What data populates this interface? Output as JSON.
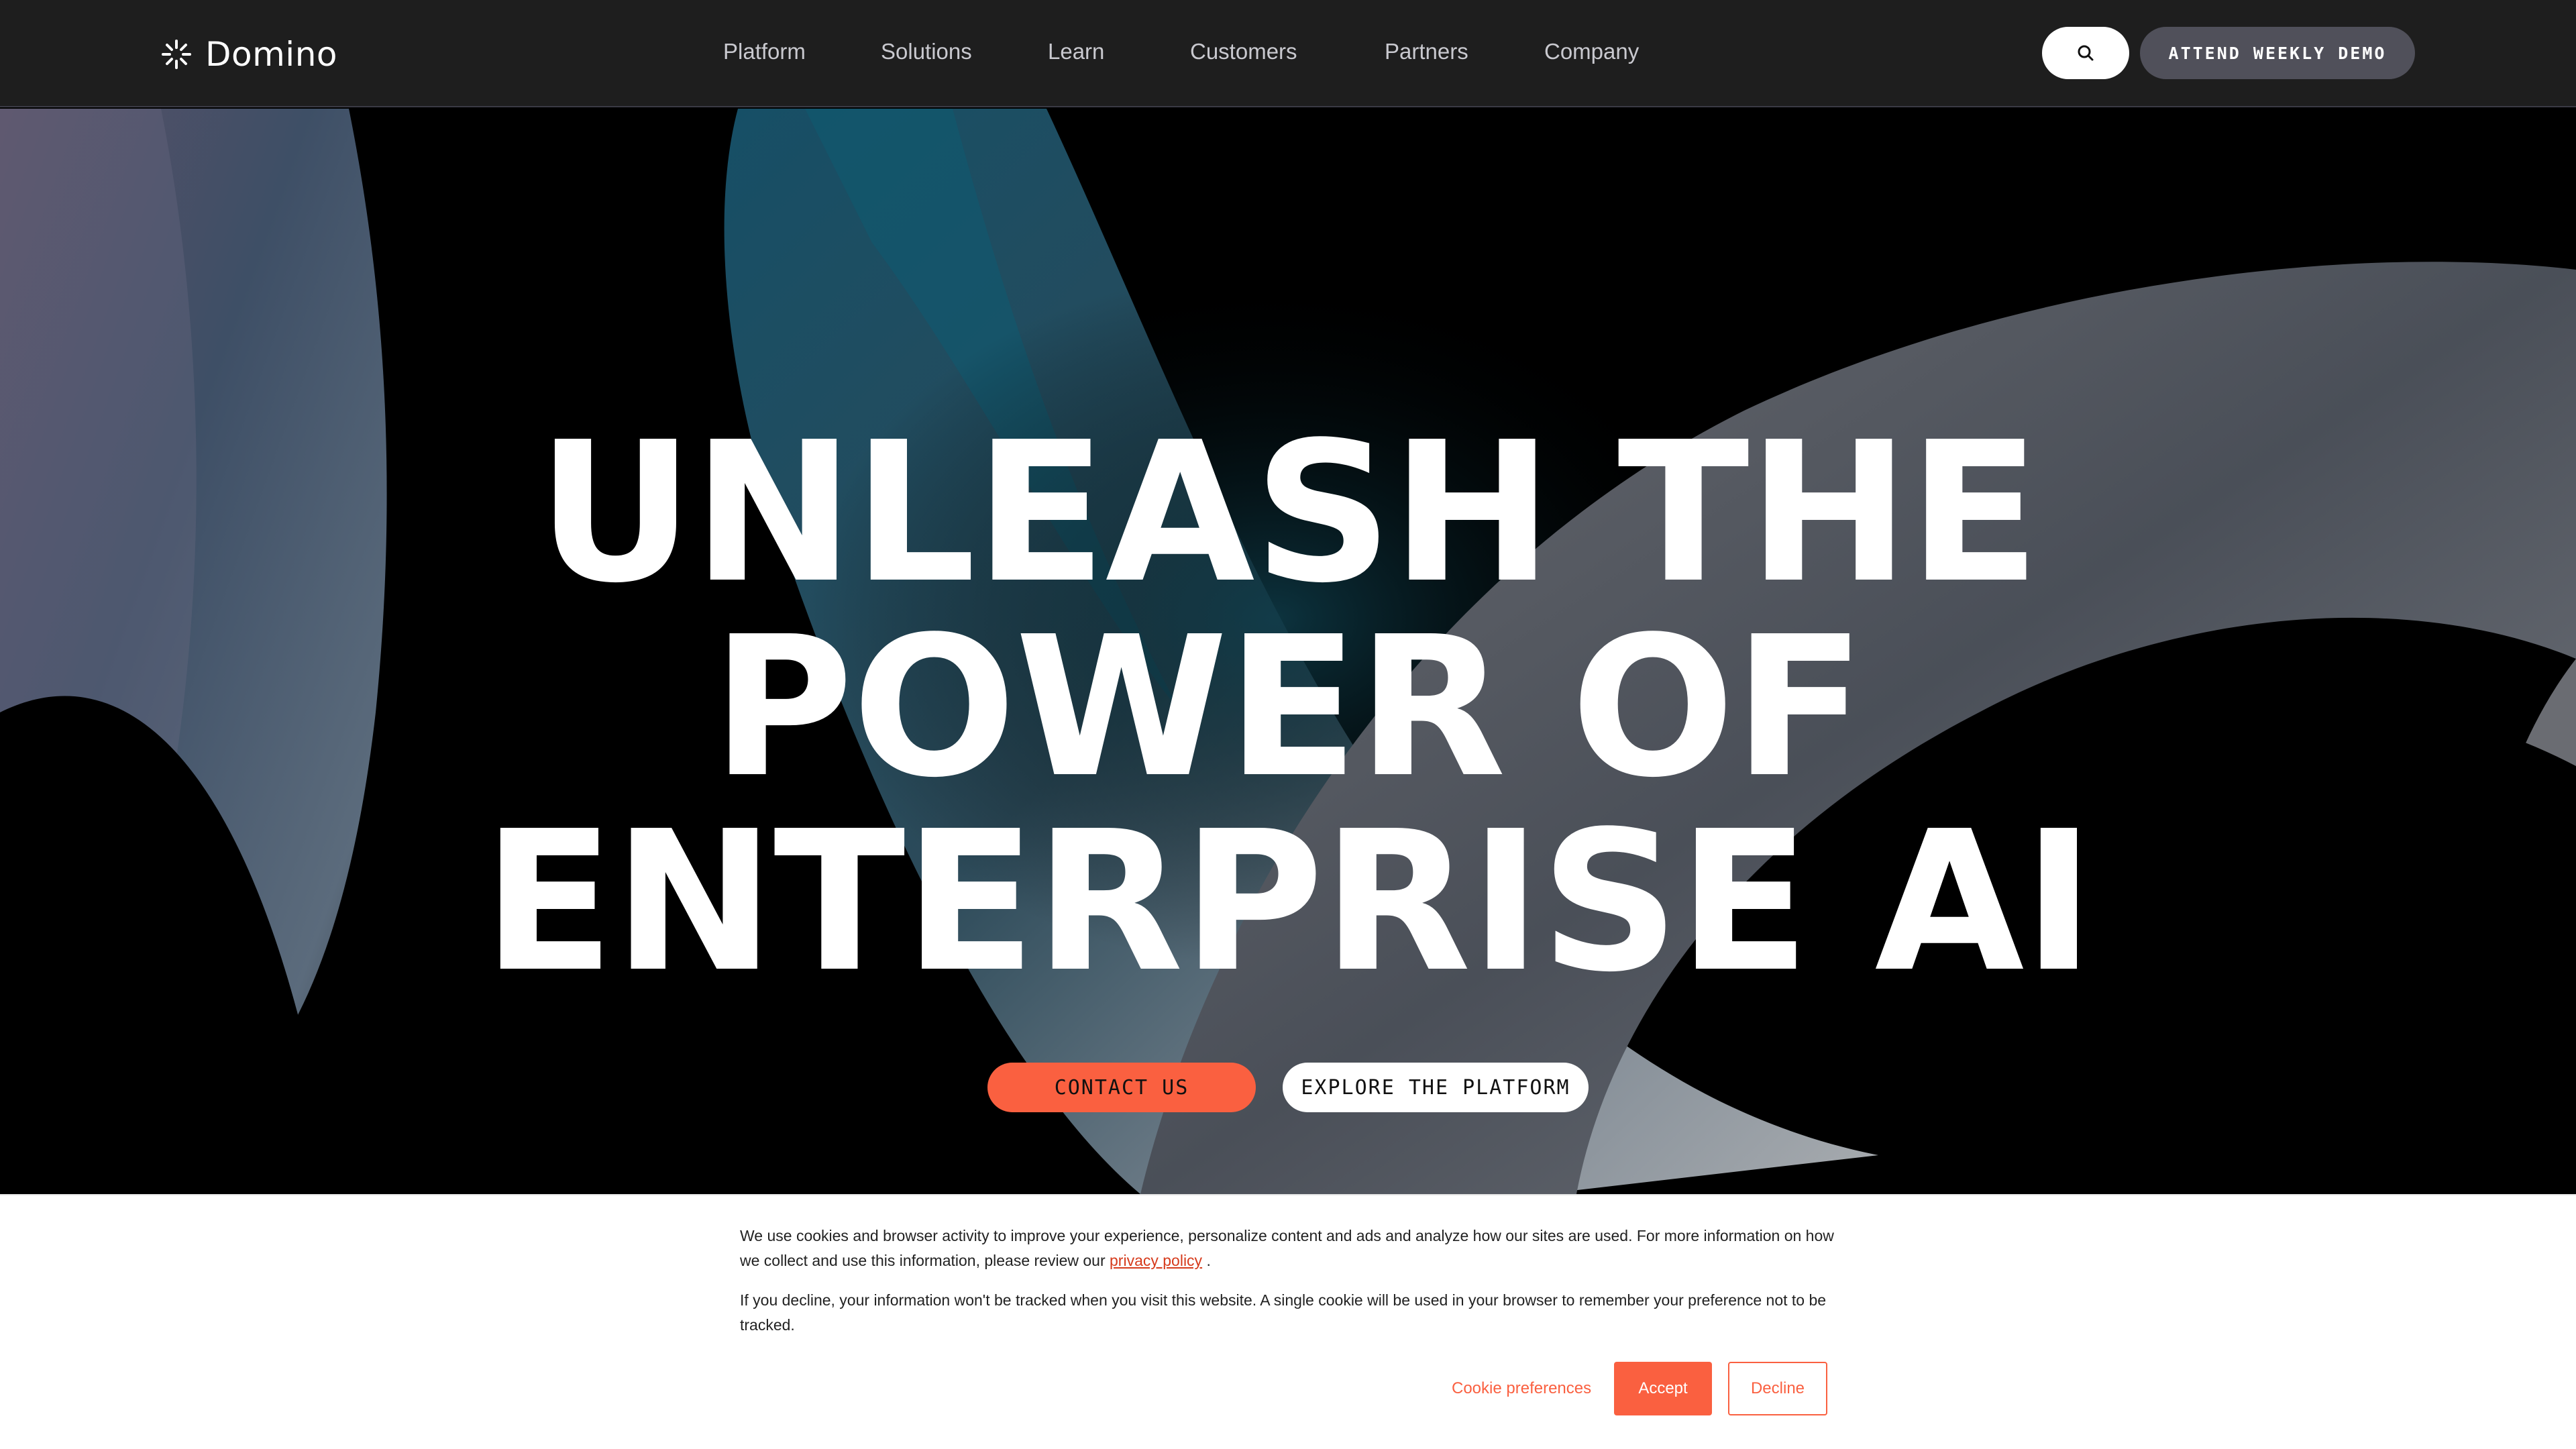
{
  "nav": {
    "logo_text": "Domino",
    "logo_icon": "domino-starburst-icon",
    "items": [
      {
        "label": "Platform"
      },
      {
        "label": "Solutions"
      },
      {
        "label": "Learn"
      },
      {
        "label": "Customers"
      },
      {
        "label": "Partners"
      },
      {
        "label": "Company"
      }
    ],
    "search_icon": "search-icon",
    "demo_label": "ATTEND WEEKLY DEMO"
  },
  "hero": {
    "headline_lines": [
      "UNLEASH THE",
      "POWER OF",
      "ENTERPRISE AI"
    ],
    "contact_label": "CONTACT US",
    "explore_label": "EXPLORE THE PLATFORM"
  },
  "cookie": {
    "p1_before": "We use cookies and browser activity to improve your experience, personalize content and ads and analyze how our sites are used. For more information on how we collect and use this information, please review our ",
    "p1_link": "privacy policy",
    "p1_after": " .",
    "p2": "If you decline, your information won't be tracked when you visit this website. A single cookie will be used in your browser to remember your preference not to be tracked.",
    "preferences_label": "Cookie preferences",
    "accept_label": "Accept",
    "decline_label": "Decline"
  },
  "colors": {
    "nav_bg": "#1e1e1e",
    "accent": "#fa6040",
    "demo_btn_bg": "#50505a"
  }
}
